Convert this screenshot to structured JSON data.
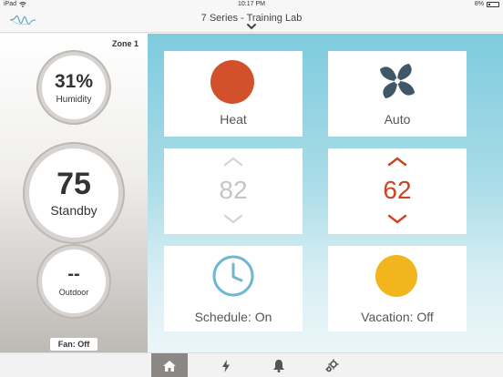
{
  "status_bar": {
    "device": "iPad",
    "time": "10:17 PM",
    "battery": "8%"
  },
  "nav": {
    "title": "7 Series - Training Lab"
  },
  "left_panel": {
    "zone": "Zone 1",
    "humidity": {
      "value": "31%",
      "label": "Humidity"
    },
    "temperature": {
      "value": "75",
      "label": "Standby"
    },
    "outdoor": {
      "value": "--",
      "label": "Outdoor"
    },
    "fan": "Fan: Off"
  },
  "tiles": {
    "mode": {
      "label": "Heat",
      "color": "#d2502c"
    },
    "fan": {
      "label": "Auto",
      "color": "#3f5766"
    },
    "cool_setpoint": {
      "value": "82",
      "color": "#c5c5c5"
    },
    "heat_setpoint": {
      "value": "62",
      "color": "#cc4422"
    },
    "schedule": {
      "label": "Schedule: On",
      "color": "#6fb8cf"
    },
    "vacation": {
      "label": "Vacation: Off",
      "color": "#f2b51d"
    }
  },
  "tab_bar": {
    "items": [
      {
        "icon": "home-icon",
        "active": true
      },
      {
        "icon": "bolt-icon",
        "active": false
      },
      {
        "icon": "bell-icon",
        "active": false
      },
      {
        "icon": "gear-icon",
        "active": false
      }
    ]
  }
}
